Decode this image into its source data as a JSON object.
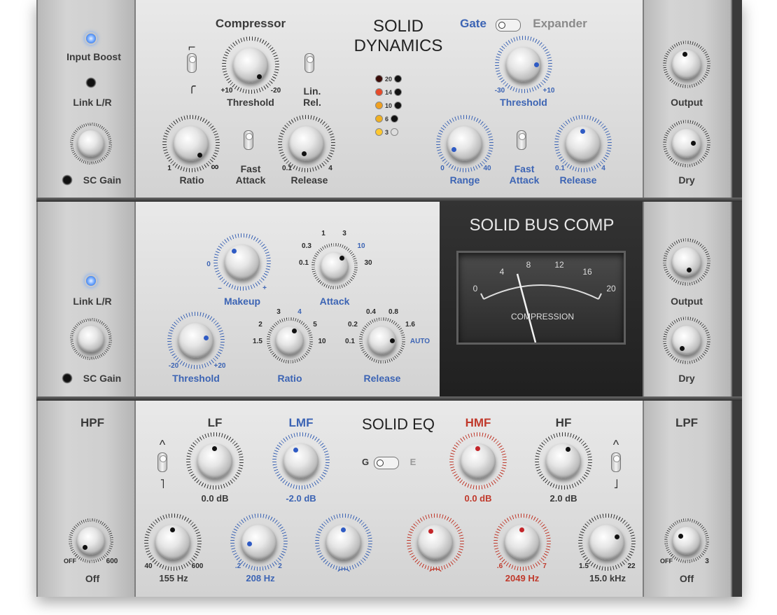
{
  "dynamics": {
    "input_boost": "Input Boost",
    "link_lr": "Link L/R",
    "sc_gain": "SC Gain",
    "compressor_title": "Compressor",
    "title_line1": "SOLID",
    "title_line2": "DYNAMICS",
    "gate_label": "Gate",
    "expander_label": "Expander",
    "comp_threshold": {
      "label": "Threshold",
      "min": "+10",
      "max": "-20"
    },
    "lin_rel": "Lin.\nRel.",
    "comp_ratio": {
      "label": "Ratio",
      "min": "1",
      "max": "∞"
    },
    "fast_attack": "Fast\nAttack",
    "comp_release": {
      "label": "Release",
      "min": "0.1",
      "max": "4"
    },
    "meter_values": [
      "20",
      "14",
      "10",
      "6",
      "3"
    ],
    "gate_threshold": {
      "label": "Threshold",
      "min": "-30",
      "max": "+10"
    },
    "range": {
      "label": "Range",
      "min": "0",
      "max": "40"
    },
    "gate_fast_attack": "Fast\nAttack",
    "gate_release": {
      "label": "Release",
      "min": "0.1",
      "max": "4"
    },
    "output": "Output",
    "dry": "Dry"
  },
  "bus_comp": {
    "link_lr": "Link L/R",
    "sc_gain": "SC Gain",
    "makeup": {
      "label": "Makeup",
      "min": "0",
      "minus": "–",
      "plus": "+"
    },
    "attack": {
      "label": "Attack",
      "ticks": [
        "0.1",
        "0.3",
        "1",
        "3",
        "10",
        "30"
      ]
    },
    "threshold": {
      "label": "Threshold",
      "min": "-20",
      "max": "+20"
    },
    "ratio": {
      "label": "Ratio",
      "ticks": [
        "1.5",
        "2",
        "3",
        "4",
        "5",
        "10"
      ]
    },
    "release": {
      "label": "Release",
      "ticks": [
        "0.1",
        "0.2",
        "0.4",
        "0.8",
        "1.6",
        "AUTO"
      ]
    },
    "title": "SOLID BUS COMP",
    "vu_scale": [
      "0",
      "4",
      "8",
      "12",
      "16",
      "20"
    ],
    "vu_label": "COMPRESSION",
    "output": "Output",
    "dry": "Dry"
  },
  "eq": {
    "hpf": "HPF",
    "hpf_knob": {
      "min": "OFF",
      "max": "600",
      "value": "Off"
    },
    "title": "SOLID EQ",
    "lf": {
      "label": "LF",
      "gain": "0.0 dB",
      "freq": "155 Hz",
      "fmin": "40",
      "fmax": "600"
    },
    "lmf": {
      "label": "LMF",
      "gain": "-2.0 dB",
      "freq": "208 Hz",
      "fmin": ".2",
      "fmax": "2"
    },
    "hmf": {
      "label": "HMF",
      "gain": "0.0 dB",
      "freq": "2049 Hz",
      "fmin": ".6",
      "fmax": "7"
    },
    "hf": {
      "label": "HF",
      "gain": "2.0 dB",
      "freq": "15.0 kHz",
      "fmin": "1.5",
      "fmax": "22"
    },
    "switch_g": "G",
    "switch_e": "E",
    "lpf": "LPF",
    "lpf_knob": {
      "min": "OFF",
      "max": "3",
      "value": "Off"
    }
  },
  "colors": {
    "blue": "#3c64b4",
    "red": "#c0392b"
  }
}
